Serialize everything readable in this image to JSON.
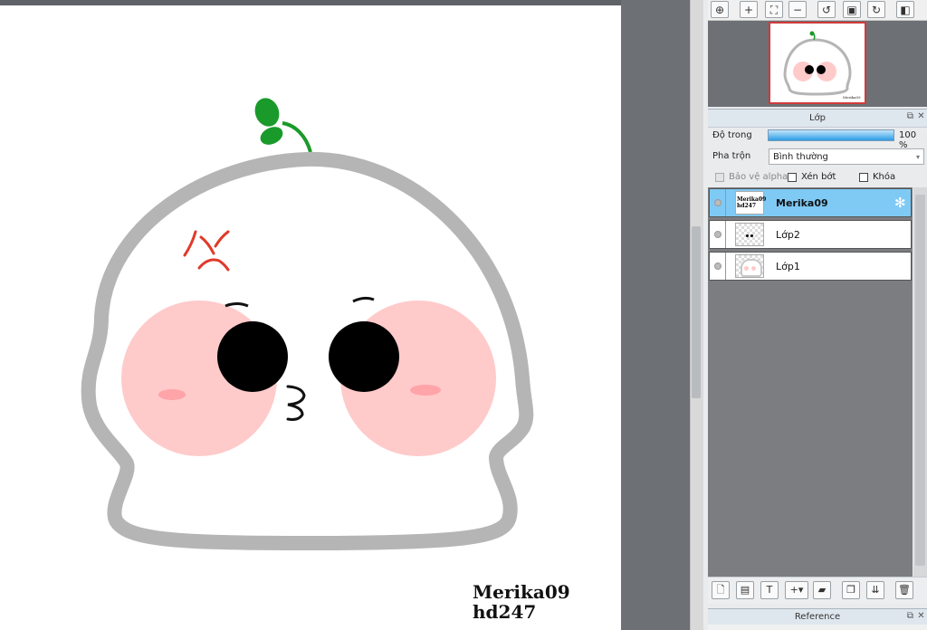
{
  "canvas": {
    "signature_line1": "Merika09",
    "signature_line2": "hd247"
  },
  "navigator": {
    "toolbar_icons": [
      "zoom-fit-icon",
      "zoom-in-icon",
      "fit-screen-icon",
      "zoom-out-icon",
      "rotate-left-icon",
      "actual-size-icon",
      "rotate-right-icon",
      "flip-icon"
    ]
  },
  "layer_panel": {
    "title": "Lớp",
    "opacity_label": "Độ trong",
    "opacity_value": "100 %",
    "opacity_level": 1.0,
    "blend_label": "Pha trộn",
    "blend_value": "Bình thường",
    "protect_alpha_label": "Bảo vệ alpha",
    "clip_label": "Xén bớt",
    "lock_label": "Khóa",
    "layers": [
      {
        "name": "Merika09",
        "selected": true
      },
      {
        "name": "Lớp2",
        "selected": false
      },
      {
        "name": "Lớp1",
        "selected": false
      }
    ],
    "toolbar_icons": [
      "new-layer-icon",
      "new-raster-icon",
      "new-text-icon",
      "add-dropdown-icon",
      "folder-icon",
      "duplicate-icon",
      "merge-icon",
      "delete-icon"
    ]
  },
  "reference_panel": {
    "title": "Reference"
  },
  "colors": {
    "selection": "#7fcaf5",
    "canvas_bg": "#6d7075",
    "outline_gray": "#b5b5b5",
    "blush": "#ffc9c9"
  }
}
